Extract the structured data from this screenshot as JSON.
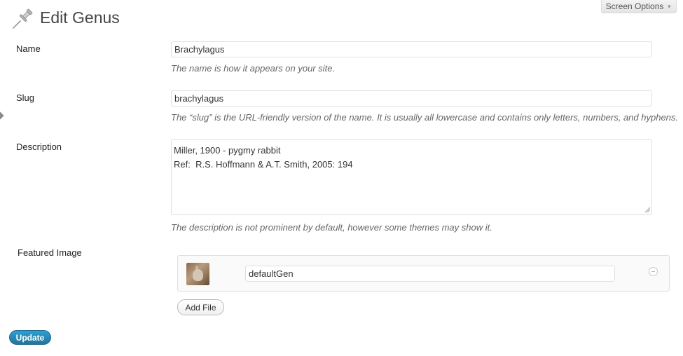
{
  "header": {
    "title": "Edit Genus",
    "screen_options_label": "Screen Options",
    "title_icon": "pushpin-icon"
  },
  "form": {
    "name": {
      "label": "Name",
      "value": "Brachylagus",
      "help": "The name is how it appears on your site."
    },
    "slug": {
      "label": "Slug",
      "value": "brachylagus",
      "help": "The “slug” is the URL-friendly version of the name. It is usually all lowercase and contains only letters, numbers, and hyphens."
    },
    "description": {
      "label": "Description",
      "value": "Miller, 1900 - pygmy rabbit\nRef:  R.S. Hoffmann & A.T. Smith, 2005: 194",
      "help": "The description is not prominent by default, however some themes may show it."
    },
    "featured_image": {
      "label": "Featured Image",
      "file_name": "defaultGen",
      "add_file_label": "Add File",
      "thumbnail_icon": "rabbit-thumbnail",
      "remove_icon": "remove-circle-icon"
    },
    "submit_label": "Update"
  },
  "colors": {
    "primary_button": "#21759b",
    "help_text": "#666666",
    "border": "#dfdfdf"
  }
}
